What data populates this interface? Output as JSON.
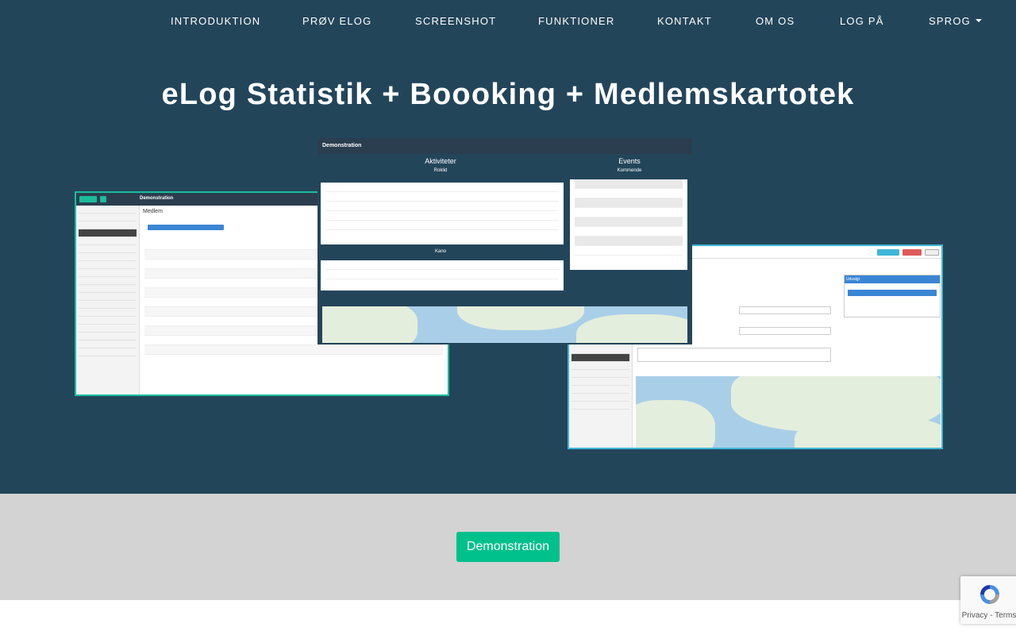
{
  "nav": {
    "items": [
      "INTRODUKTION",
      "PRØV ELOG",
      "SCREENSHOT",
      "FUNKTIONER",
      "KONTAKT",
      "OM OS",
      "LOG PÅ"
    ],
    "language_label": "SPROG"
  },
  "hero": {
    "title_bold": "eLog",
    "title_rest": " Statistik + Boooking + Medlemskartotek"
  },
  "screens": {
    "left_app_title": "Demonstration",
    "left_page_title": "Medlem",
    "center_title": "Demonstration",
    "center_left_heading": "Aktiviteter",
    "center_left_sub": "Roklid",
    "center_left_sub2": "Kano",
    "center_right_heading": "Events",
    "center_right_sub": "Kommende",
    "right_panel_heading": "Udvalgt"
  },
  "demo": {
    "button_label": "Demonstration"
  },
  "recaptcha": {
    "links": "Privacy - Terms"
  },
  "colors": {
    "hero_bg": "#23455a",
    "demo_strip_bg": "#d3d3d3",
    "accent_green": "#00c08b",
    "frame_teal": "#1abc9c",
    "frame_blue": "#3fb6d6"
  }
}
